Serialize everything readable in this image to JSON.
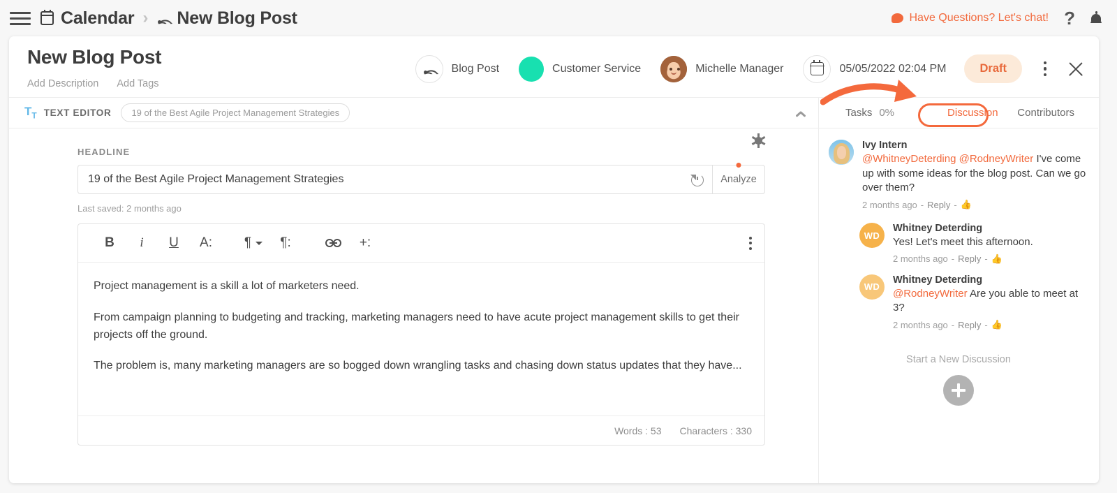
{
  "topbar": {
    "menu_icon": "hamburger-icon",
    "breadcrumb": [
      {
        "icon": "calendar-icon",
        "label": "Calendar"
      },
      {
        "icon": "rss-icon",
        "label": "New Blog Post"
      }
    ],
    "separator": "›",
    "chat_label": "Have Questions? Let's chat!",
    "help_label": "?",
    "bell_icon": "bell-icon",
    "accent_color": "#f2693c"
  },
  "card": {
    "title": "New Blog Post",
    "add_description": "Add Description",
    "add_tags": "Add Tags",
    "meta": {
      "type_icon": "rss-icon",
      "type_label": "Blog Post",
      "tag_color": "#18e0b0",
      "tag_label": "Customer Service",
      "owner_label": "Michelle Manager",
      "date_icon": "calendar-icon",
      "date_label": "05/05/2022 02:04 PM",
      "status_label": "Draft",
      "status_bg": "#fcead9",
      "status_color": "#e8693b",
      "more_icon": "kebab-menu-icon",
      "close_icon": "close-icon"
    }
  },
  "editor": {
    "strip_icon": "text-format-icon",
    "strip_label": "TEXT EDITOR",
    "strip_pill": "19 of the Best Agile Project Management Strategies",
    "collapse_icon": "chevron-up-icon",
    "headline_label": "HEADLINE",
    "settings_icon": "gear-icon",
    "headline_value": "19 of the Best Agile Project Management Strategies",
    "revert_icon": "revert-history-icon",
    "analyze_label": "Analyze",
    "analyze_dot_color": "#f4693c",
    "last_saved": "Last saved: 2 months ago",
    "toolbar": [
      {
        "name": "bold-icon",
        "glyph": "B"
      },
      {
        "name": "italic-icon",
        "glyph": "i"
      },
      {
        "name": "underline-icon",
        "glyph": "U"
      },
      {
        "name": "font-color-icon",
        "glyph": "A:"
      },
      {
        "name": "paragraph-style-icon",
        "glyph": "¶"
      },
      {
        "name": "paragraph-options-icon",
        "glyph": "¶:"
      },
      {
        "name": "link-icon",
        "glyph": "link"
      },
      {
        "name": "insert-icon",
        "glyph": "+:"
      },
      {
        "name": "editor-more-icon",
        "glyph": "kebab"
      }
    ],
    "paragraphs": [
      "Project management is a skill a lot of marketers need.",
      "From campaign planning to budgeting and tracking, marketing managers need to have acute project management skills to get their projects off the ground.",
      "The problem is, many marketing managers are so bogged down wrangling tasks and chasing down status updates that they have..."
    ],
    "words_label": "Words : 53",
    "characters_label": "Characters : 330"
  },
  "panel": {
    "tabs": [
      {
        "label": "Tasks",
        "suffix": "0%",
        "active": false
      },
      {
        "label": "Discussion",
        "suffix": "",
        "active": true
      },
      {
        "label": "Contributors",
        "suffix": "",
        "active": false
      }
    ],
    "highlight_color": "#f4693c",
    "comments": [
      {
        "avatar": "photo",
        "initials": "",
        "name": "Ivy Intern",
        "mentions": "@WhitneyDeterding  @RodneyWriter",
        "text": " I've come up with some ideas for the blog post. Can we go over them?",
        "time": "2 months ago",
        "reply": "Reply",
        "like_icon": "thumbs-up-icon",
        "indent": false
      },
      {
        "avatar": "initials",
        "initials": "WD",
        "name": "Whitney Deterding",
        "mentions": "",
        "text": "Yes! Let's meet this afternoon.",
        "time": "2 months ago",
        "reply": "Reply",
        "like_icon": "thumbs-up-icon",
        "indent": true
      },
      {
        "avatar": "initials",
        "initials": "WD",
        "name": "Whitney Deterding",
        "mentions": "@RodneyWriter",
        "text": " Are you able to meet at 3?",
        "time": "2 months ago",
        "reply": "Reply",
        "like_icon": "thumbs-up-icon",
        "indent": true
      }
    ],
    "new_discussion_label": "Start a New Discussion",
    "new_discussion_icon": "plus-icon"
  }
}
